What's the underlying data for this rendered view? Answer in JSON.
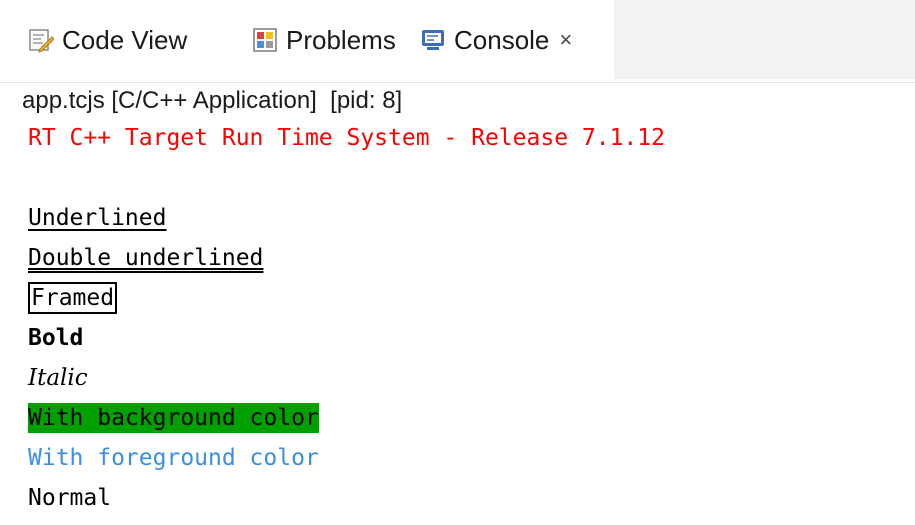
{
  "tabs": {
    "code_view": {
      "label": "Code View",
      "icon": "code-view-icon"
    },
    "problems": {
      "label": "Problems",
      "icon": "problems-icon"
    },
    "console": {
      "label": "Console",
      "icon": "console-icon",
      "close": "×",
      "active": true
    }
  },
  "process_label": "app.tcjs [C/C++ Application]  [pid: 8]",
  "console_lines": {
    "header": "RT C++ Target Run Time System - Release 7.1.12",
    "underlined": "Underlined",
    "double_underlined": "Double underlined",
    "framed": "Framed",
    "bold": "Bold",
    "italic": "Italic",
    "background": "With background color",
    "foreground": "With foreground color",
    "normal": "Normal"
  },
  "colors": {
    "header": "#ff0000",
    "background_highlight": "#00a000",
    "foreground_text": "#3b8ee6"
  }
}
